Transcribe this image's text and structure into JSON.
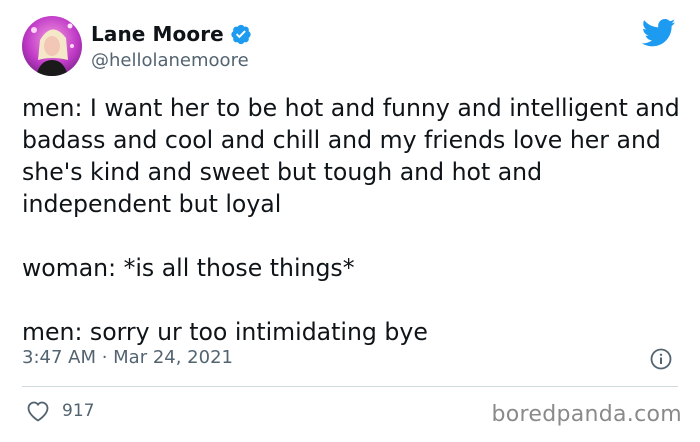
{
  "user": {
    "display_name": "Lane Moore",
    "handle": "@hellolanemoore",
    "verified": true
  },
  "tweet": {
    "paragraphs": [
      "men: I want her to be hot and funny and intelligent and badass and cool and chill and my friends love her and she's kind and sweet but tough and hot and independent but loyal",
      "woman: *is all those things*",
      "men: sorry ur too intimidating bye"
    ],
    "timestamp": "3:47 AM · Mar 24, 2021",
    "like_count": "917"
  },
  "watermark": "boredpanda.com",
  "icons": {
    "brand": "twitter-bird-icon",
    "verified": "verified-badge-icon",
    "info": "info-icon",
    "like": "heart-icon"
  },
  "colors": {
    "twitter_blue": "#1d9bf0",
    "text_primary": "#0f1419",
    "text_secondary": "#536471",
    "divider": "#cfd9de"
  }
}
